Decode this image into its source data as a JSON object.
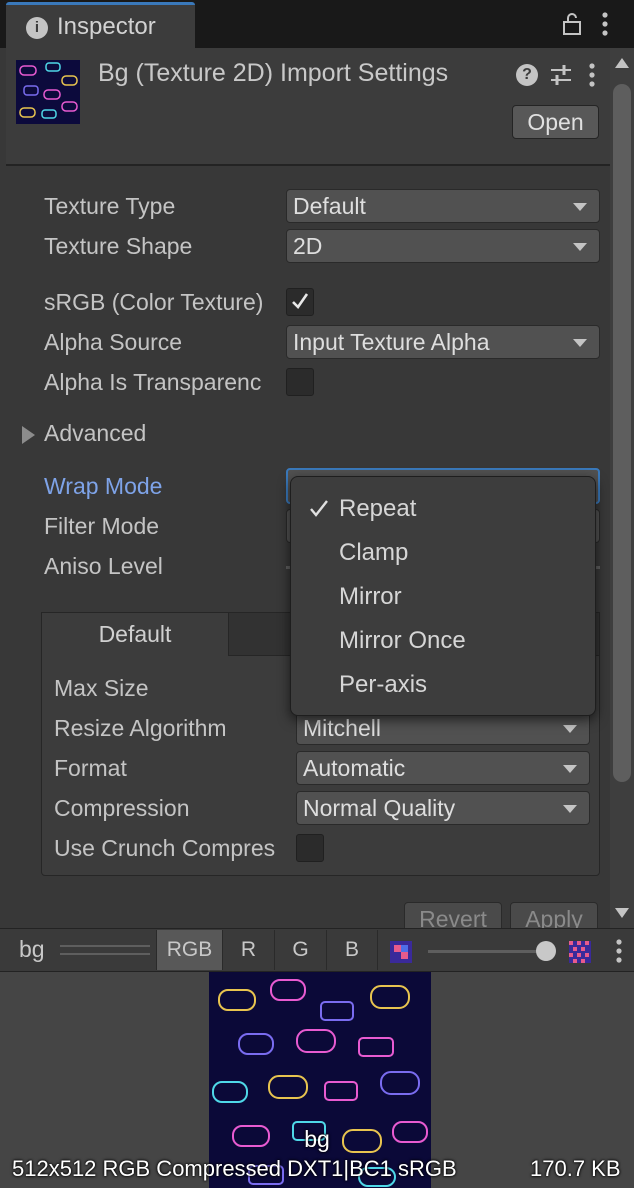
{
  "window": {
    "tab_title": "Inspector",
    "tab_icon": "info-icon"
  },
  "header": {
    "title": "Bg (Texture 2D) Import Settings",
    "open_label": "Open"
  },
  "properties": {
    "texture_type": {
      "label": "Texture Type",
      "value": "Default"
    },
    "texture_shape": {
      "label": "Texture Shape",
      "value": "2D"
    },
    "srgb": {
      "label": "sRGB (Color Texture)",
      "checked": true
    },
    "alpha_source": {
      "label": "Alpha Source",
      "value": "Input Texture Alpha"
    },
    "alpha_is_transparency": {
      "label": "Alpha Is Transparenc",
      "checked": false
    },
    "advanced": {
      "label": "Advanced",
      "expanded": false
    },
    "wrap_mode": {
      "label": "Wrap Mode",
      "value": ""
    },
    "filter_mode": {
      "label": "Filter Mode"
    },
    "aniso_level": {
      "label": "Aniso Level"
    }
  },
  "platform": {
    "active_tab": "Default",
    "max_size": {
      "label": "Max Size"
    },
    "resize_algorithm": {
      "label": "Resize Algorithm",
      "value": "Mitchell"
    },
    "format": {
      "label": "Format",
      "value": "Automatic"
    },
    "compression": {
      "label": "Compression",
      "value": "Normal Quality"
    },
    "use_crunch": {
      "label": "Use Crunch Compres",
      "checked": false
    }
  },
  "actions": {
    "revert_label": "Revert",
    "apply_label": "Apply"
  },
  "wrap_menu": {
    "items": [
      "Repeat",
      "Clamp",
      "Mirror",
      "Mirror Once",
      "Per-axis"
    ],
    "selected": "Repeat"
  },
  "preview": {
    "name": "bg",
    "channels": [
      "RGB",
      "R",
      "G",
      "B"
    ],
    "active_channel": "RGB",
    "mip_level": 1.0,
    "caption": "bg",
    "info": "512x512  RGB Compressed DXT1|BC1 sRGB",
    "size": "170.7 KB"
  },
  "colors": {
    "accent": "#3a79bb",
    "active_label": "#7ea3e8",
    "background": "#383838"
  }
}
